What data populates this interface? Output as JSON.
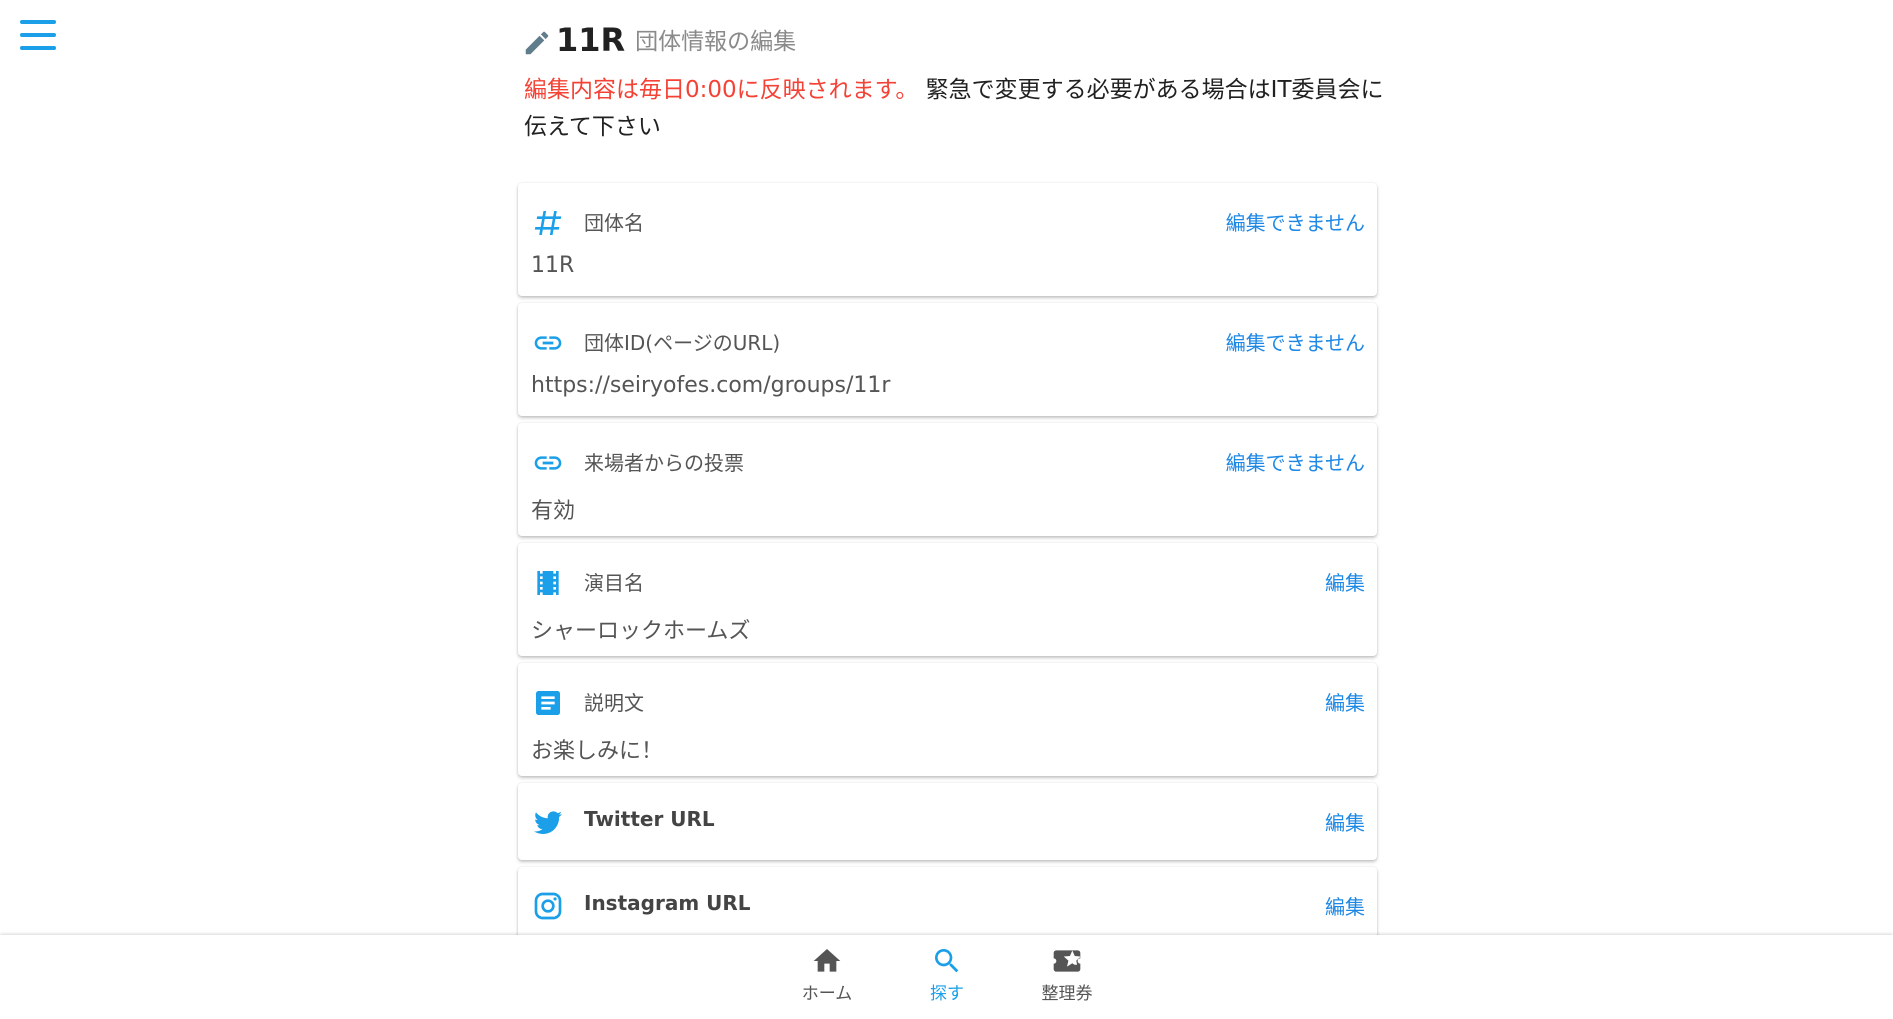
{
  "header": {
    "title": "11R",
    "subtitle": "団体情報の編集"
  },
  "notice": {
    "highlight": "編集内容は毎日0:00に反映されます。",
    "rest": "緊急で変更する必要がある場合はIT委員会に伝えて下さい"
  },
  "fields": [
    {
      "icon": "hash-icon",
      "label": "団体名",
      "action": "編集できません",
      "value": "11R"
    },
    {
      "icon": "link-icon",
      "label": "団体ID(ページのURL)",
      "action": "編集できません",
      "value": "https://seiryofes.com/groups/11r"
    },
    {
      "icon": "link-icon",
      "label": "来場者からの投票",
      "action": "編集できません",
      "value": "有効"
    },
    {
      "icon": "film-icon",
      "label": "演目名",
      "action": "編集",
      "value": "シャーロックホームズ"
    },
    {
      "icon": "document-icon",
      "label": "説明文",
      "action": "編集",
      "value": "お楽しみに！"
    },
    {
      "icon": "twitter-icon",
      "label": "Twitter URL",
      "action": "編集"
    },
    {
      "icon": "instagram-icon",
      "label": "Instagram URL",
      "action": "編集"
    }
  ],
  "bottom_nav": [
    {
      "label": "ホーム",
      "icon": "home-icon",
      "active": false
    },
    {
      "label": "探す",
      "icon": "search-icon",
      "active": true
    },
    {
      "label": "整理券",
      "icon": "ticket-icon",
      "active": false
    }
  ],
  "colors": {
    "accent": "#1a9fe8",
    "link": "#1e88e5",
    "warning": "#f44336",
    "nav_inactive": "#555555"
  }
}
